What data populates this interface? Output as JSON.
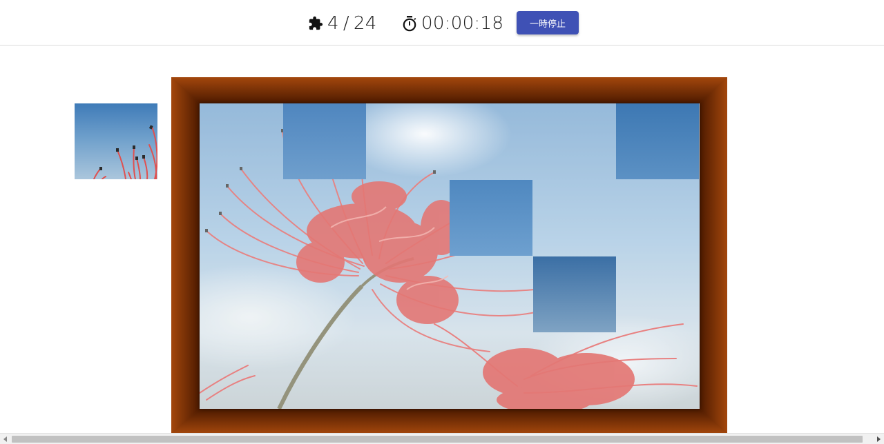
{
  "header": {
    "pieces_placed": "4",
    "pieces_separator": "/",
    "pieces_total": "24",
    "timer": "00:00:18",
    "pause_label": "一時停止"
  },
  "icons": {
    "pieces": "puzzle-piece-icon",
    "timer": "stopwatch-icon"
  },
  "puzzle": {
    "grid_columns": 6,
    "grid_rows": 4,
    "placed_pieces": [
      {
        "row": 0,
        "col": 1
      },
      {
        "row": 0,
        "col": 5
      },
      {
        "row": 1,
        "col": 3
      },
      {
        "row": 2,
        "col": 4
      }
    ]
  },
  "colors": {
    "accent": "#3f51b5",
    "frame": "#a0440a",
    "flower": "#e0504f"
  }
}
